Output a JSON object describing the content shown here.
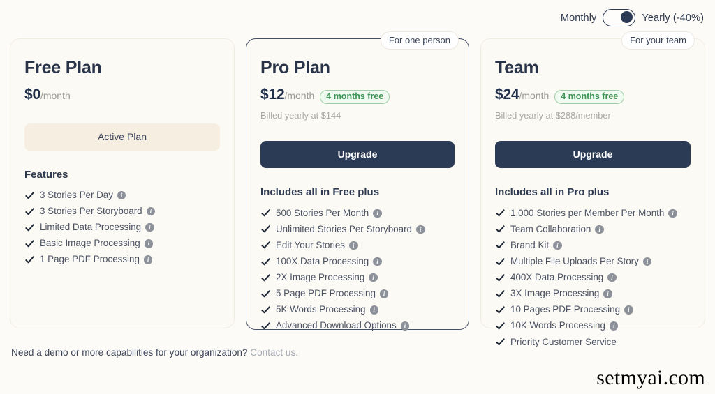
{
  "billing": {
    "monthly_label": "Monthly",
    "yearly_label": "Yearly (-40%)",
    "selected": "yearly"
  },
  "plans": [
    {
      "id": "free",
      "name": "Free Plan",
      "price": "$0",
      "per": "/month",
      "badge": null,
      "discount_badge": null,
      "billed_note": null,
      "cta": "Active Plan",
      "cta_style": "active",
      "features_title": "Features",
      "features": [
        {
          "label": "3 Stories Per Day",
          "info": true
        },
        {
          "label": "3 Stories Per Storyboard",
          "info": true
        },
        {
          "label": "Limited Data Processing",
          "info": true
        },
        {
          "label": "Basic Image Processing",
          "info": true
        },
        {
          "label": "1 Page PDF Processing",
          "info": true
        }
      ]
    },
    {
      "id": "pro",
      "name": "Pro Plan",
      "price": "$12",
      "per": "/month",
      "badge": "For one person",
      "discount_badge": "4 months free",
      "billed_note": "Billed yearly at $144",
      "cta": "Upgrade",
      "cta_style": "upgrade",
      "features_title": "Includes all in Free plus",
      "features": [
        {
          "label": "500 Stories Per Month",
          "info": true
        },
        {
          "label": "Unlimited Stories Per Storyboard",
          "info": true
        },
        {
          "label": "Edit Your Stories",
          "info": true
        },
        {
          "label": "100X Data Processing",
          "info": true
        },
        {
          "label": "2X Image Processing",
          "info": true
        },
        {
          "label": "5 Page PDF Processing",
          "info": true
        },
        {
          "label": "5K Words Processing",
          "info": true
        },
        {
          "label": "Advanced Download Options",
          "info": true
        }
      ]
    },
    {
      "id": "team",
      "name": "Team",
      "price": "$24",
      "per": "/month",
      "badge": "For your team",
      "discount_badge": "4 months free",
      "billed_note": "Billed yearly at $288/member",
      "cta": "Upgrade",
      "cta_style": "upgrade",
      "features_title": "Includes all in Pro plus",
      "features": [
        {
          "label": "1,000 Stories per Member Per Month",
          "info": true
        },
        {
          "label": "Team Collaboration",
          "info": true
        },
        {
          "label": "Brand Kit",
          "info": true
        },
        {
          "label": "Multiple File Uploads Per Story",
          "info": true
        },
        {
          "label": "400X Data Processing",
          "info": true
        },
        {
          "label": "3X Image Processing",
          "info": true
        },
        {
          "label": "10 Pages PDF Processing",
          "info": true
        },
        {
          "label": "10K Words Processing",
          "info": true
        },
        {
          "label": "Priority Customer Service",
          "info": false
        }
      ]
    }
  ],
  "footer": {
    "text": "Need a demo or more capabilities for your organization? ",
    "link": "Contact us."
  },
  "watermark": "setmyai.com",
  "colors": {
    "page_bg": "#fdfbf7",
    "card_bg": "#fcfaf5",
    "cta_dark": "#2b3b55",
    "cta_active_bg": "#f5eee1",
    "accent_green": "#3e9455",
    "text_dark": "#2a3449"
  }
}
